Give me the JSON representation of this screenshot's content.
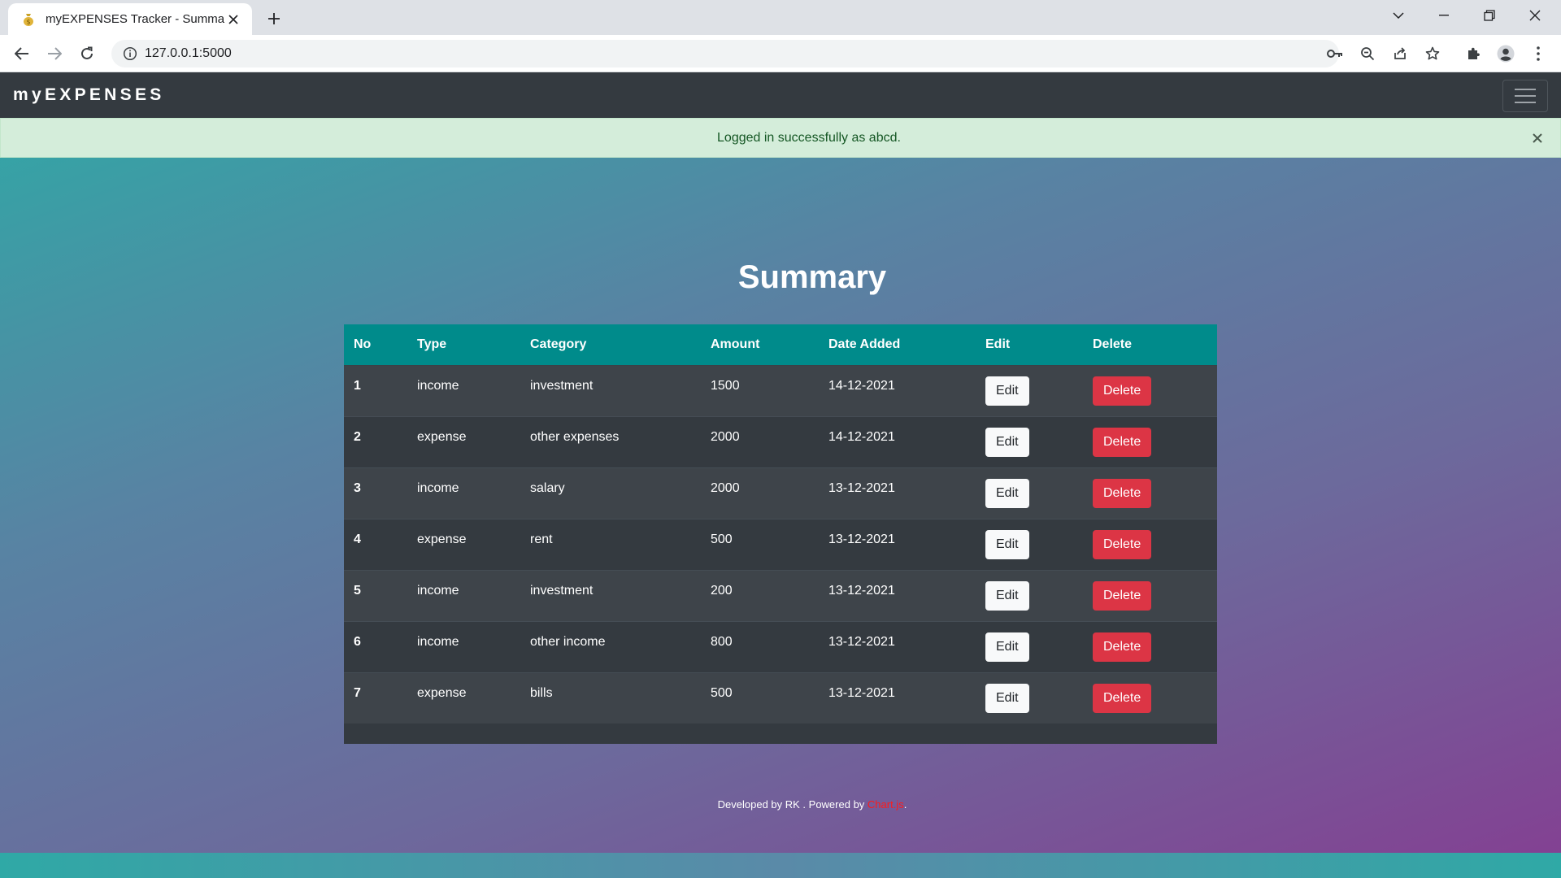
{
  "browser": {
    "tab_title": "myEXPENSES Tracker - Summary",
    "url": "127.0.0.1:5000"
  },
  "app": {
    "brand": "myEXPENSES"
  },
  "alert": {
    "message": "Logged in successfully as abcd.",
    "close_glyph": "×"
  },
  "main": {
    "title": "Summary",
    "table": {
      "headers": [
        "No",
        "Type",
        "Category",
        "Amount",
        "Date Added",
        "Edit",
        "Delete"
      ],
      "rows": [
        {
          "no": "1",
          "type": "income",
          "category": "investment",
          "amount": "1500",
          "date": "14-12-2021",
          "edit_label": "Edit",
          "delete_label": "Delete"
        },
        {
          "no": "2",
          "type": "expense",
          "category": "other expenses",
          "amount": "2000",
          "date": "14-12-2021",
          "edit_label": "Edit",
          "delete_label": "Delete"
        },
        {
          "no": "3",
          "type": "income",
          "category": "salary",
          "amount": "2000",
          "date": "13-12-2021",
          "edit_label": "Edit",
          "delete_label": "Delete"
        },
        {
          "no": "4",
          "type": "expense",
          "category": "rent",
          "amount": "500",
          "date": "13-12-2021",
          "edit_label": "Edit",
          "delete_label": "Delete"
        },
        {
          "no": "5",
          "type": "income",
          "category": "investment",
          "amount": "200",
          "date": "13-12-2021",
          "edit_label": "Edit",
          "delete_label": "Delete"
        },
        {
          "no": "6",
          "type": "income",
          "category": "other income",
          "amount": "800",
          "date": "13-12-2021",
          "edit_label": "Edit",
          "delete_label": "Delete"
        },
        {
          "no": "7",
          "type": "expense",
          "category": "bills",
          "amount": "500",
          "date": "13-12-2021",
          "edit_label": "Edit",
          "delete_label": "Delete"
        }
      ]
    }
  },
  "footer": {
    "text": "Developed by RK . Powered by ",
    "link": "Chart.js",
    "suffix": "."
  },
  "colors": {
    "navbar": "#343a40",
    "table_header": "#008b8b",
    "alert_bg": "#d4edda",
    "alert_text": "#155724",
    "delete_button": "#dc3545",
    "footer_link": "#ff1a1a"
  },
  "icons": {
    "favicon": "money-bag-icon",
    "tab_close": "close-icon",
    "new_tab": "plus-icon",
    "back": "arrow-left-icon",
    "forward": "arrow-right-icon",
    "reload": "reload-icon",
    "site_info": "info-icon",
    "passwords": "key-icon",
    "zoom": "zoom-out-icon",
    "share": "share-icon",
    "bookmark": "star-icon",
    "extensions": "puzzle-icon",
    "profile": "profile-icon",
    "menu": "kebab-menu-icon",
    "navbar_toggle": "hamburger-icon"
  }
}
